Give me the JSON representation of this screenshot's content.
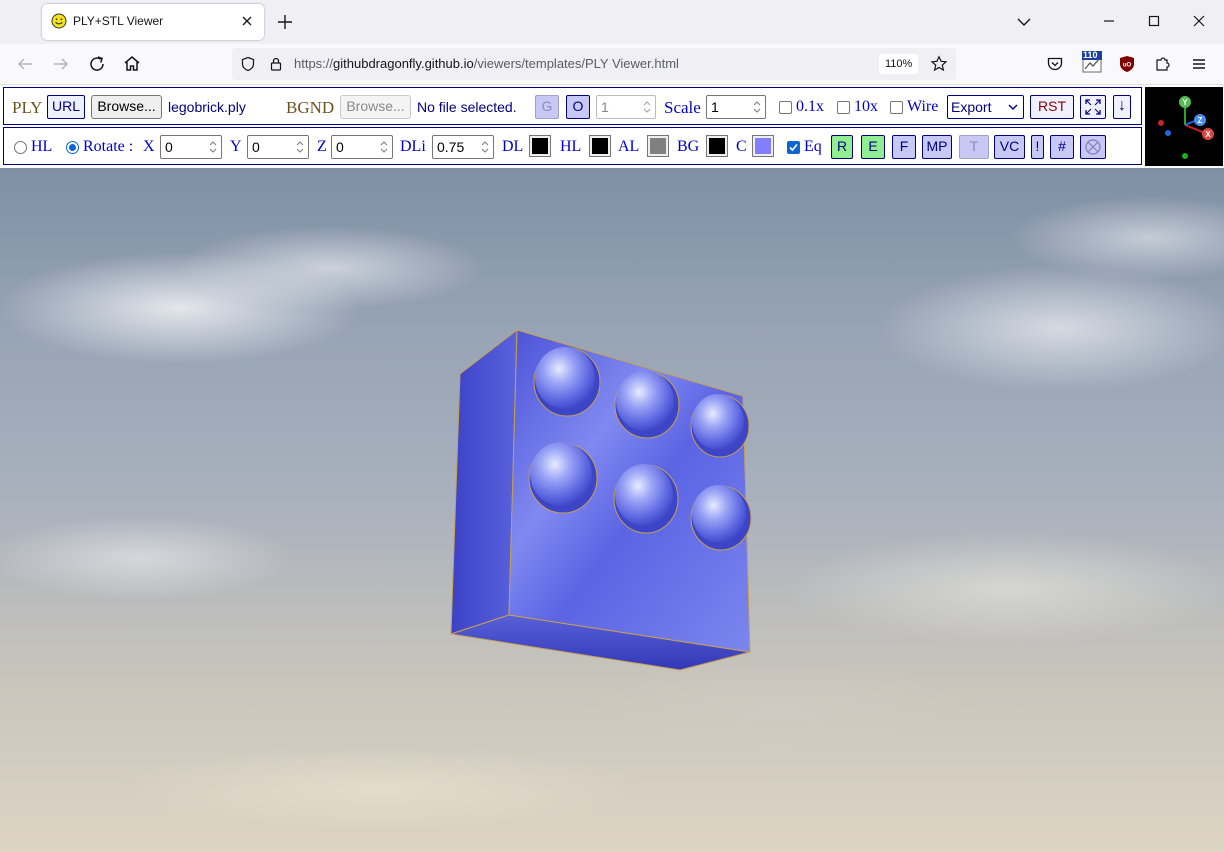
{
  "browser": {
    "tab_title": "PLY+STL Viewer",
    "url_scheme": "https://",
    "url_host": "githubdragonfly.github.io",
    "url_path": "/viewers/templates/PLY Viewer.html",
    "zoom": "110%",
    "ext_badge": "110"
  },
  "toolbar1": {
    "ply_label": "PLY",
    "url_button": "URL",
    "browse_button": "Browse...",
    "model_file": "legobrick.ply",
    "bgnd_label": "BGND",
    "bgnd_browse_button": "Browse...",
    "bgnd_file": "No file selected.",
    "g_button": "G",
    "o_button": "O",
    "spinner_value": "1",
    "scale_label": "Scale",
    "scale_value": "1",
    "scale_01_label": "0.1x",
    "scale_10_label": "10x",
    "wire_label": "Wire",
    "export_selected": "Export",
    "rst_button": "RST",
    "down_button": "↓"
  },
  "toolbar2": {
    "hl_label": "HL",
    "rotate_label": "Rotate :",
    "x_label": "X",
    "x_value": "0",
    "y_label": "Y",
    "y_value": "0",
    "z_label": "Z",
    "z_value": "0",
    "dli_label": "DLi",
    "dli_value": "0.75",
    "dl_label": "DL",
    "hl_color_label": "HL",
    "al_label": "AL",
    "bg_label": "BG",
    "c_label": "C",
    "eq_label": "Eq",
    "r_button": "R",
    "e_button": "E",
    "f_button": "F",
    "mp_button": "MP",
    "t_button": "T",
    "vc_button": "VC",
    "excl_button": "!",
    "hash_button": "#"
  },
  "colors": {
    "dl": "#000000",
    "hl": "#000000",
    "al": "#808080",
    "bg": "#000000",
    "c": "#8080ff",
    "panel_border": "#000080",
    "label_blue": "#0000cd",
    "rst_text": "#8b0000"
  },
  "axes": {
    "x": "X",
    "y": "Y",
    "z": "Z"
  }
}
